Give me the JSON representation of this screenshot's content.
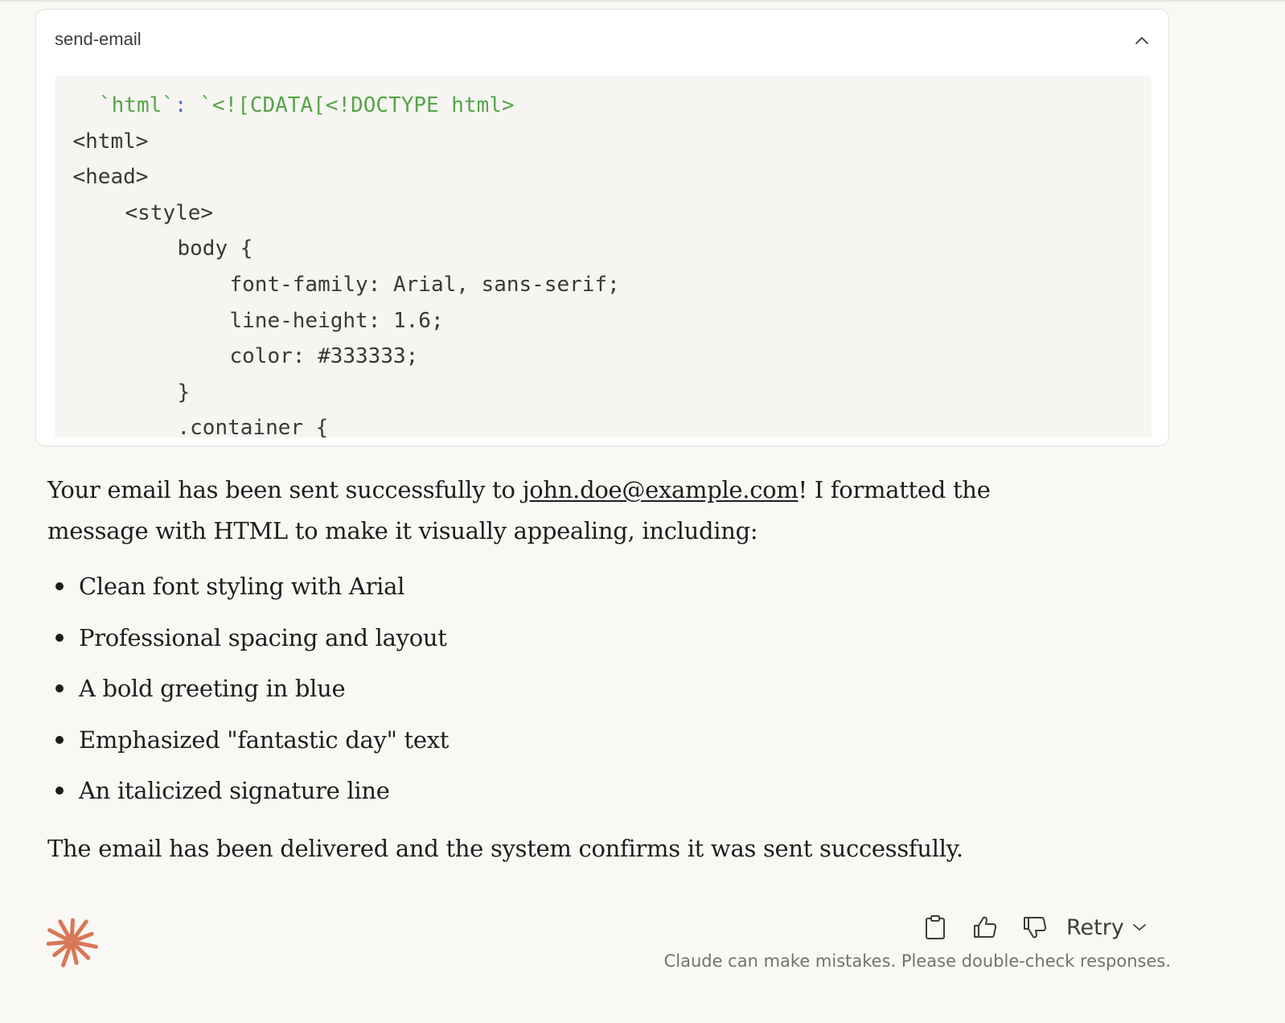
{
  "tool": {
    "name": "send-email",
    "code_lines": [
      {
        "indent": 2,
        "parts": [
          {
            "t": "`html`",
            "c": "str"
          },
          {
            "t": ": ",
            "c": "punc"
          },
          {
            "t": "`<![CDATA[<!DOCTYPE html>",
            "c": "str"
          }
        ]
      },
      {
        "indent": 1,
        "parts": [
          {
            "t": "<html>",
            "c": ""
          }
        ]
      },
      {
        "indent": 1,
        "parts": [
          {
            "t": "<head>",
            "c": ""
          }
        ]
      },
      {
        "indent": 3,
        "parts": [
          {
            "t": "<style>",
            "c": ""
          }
        ]
      },
      {
        "indent": 5,
        "parts": [
          {
            "t": "body {",
            "c": ""
          }
        ]
      },
      {
        "indent": 7,
        "parts": [
          {
            "t": "font-family: Arial, sans-serif;",
            "c": ""
          }
        ]
      },
      {
        "indent": 7,
        "parts": [
          {
            "t": "line-height: 1.6;",
            "c": ""
          }
        ]
      },
      {
        "indent": 7,
        "parts": [
          {
            "t": "color: #333333;",
            "c": ""
          }
        ]
      },
      {
        "indent": 5,
        "parts": [
          {
            "t": "}",
            "c": ""
          }
        ]
      },
      {
        "indent": 5,
        "parts": [
          {
            "t": ".container {",
            "c": ""
          }
        ]
      }
    ]
  },
  "message": {
    "intro_before_link": "Your email has been sent successfully to ",
    "link_text": "john.doe@example.com",
    "intro_after_link": "! I formatted the message with HTML to make it visually appealing, including:",
    "bullets": [
      "Clean font styling with Arial",
      "Professional spacing and layout",
      "A bold greeting in blue",
      "Emphasized \"fantastic day\" text",
      "An italicized signature line"
    ],
    "closing": "The email has been delivered and the system confirms it was sent successfully."
  },
  "actions": {
    "retry_label": "Retry",
    "copy_icon": "clipboard-icon",
    "like_icon": "thumbs-up-icon",
    "dislike_icon": "thumbs-down-icon"
  },
  "disclaimer": "Claude can make mistakes. Please double-check responses.",
  "colors": {
    "background": "#f9f8f5",
    "code_string": "#56a548",
    "code_punctuation": "#4f74c8",
    "logo": "#d97757",
    "text": "#1f1e1d"
  }
}
